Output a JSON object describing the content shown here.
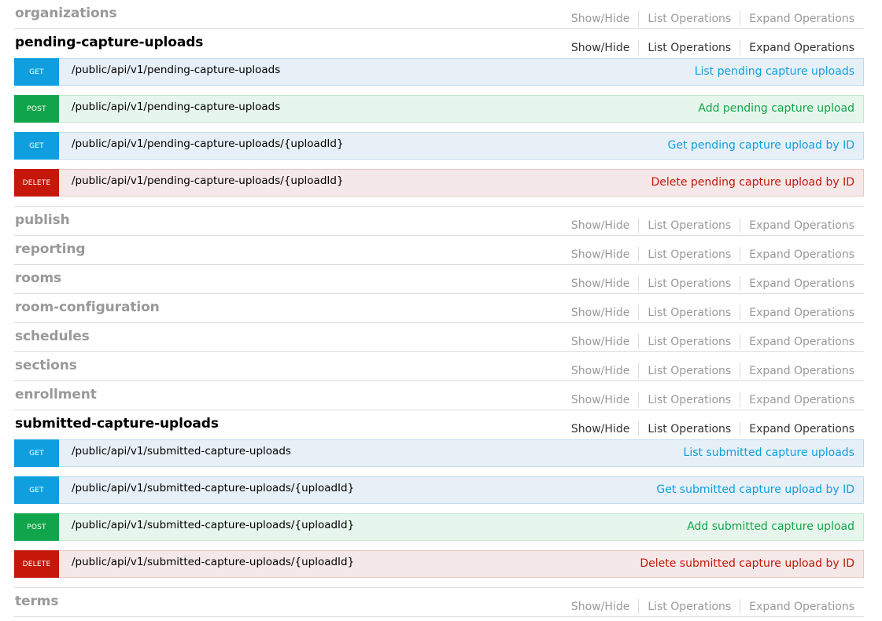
{
  "ops": {
    "show_hide": "Show/Hide",
    "list": "List Operations",
    "expand": "Expand Operations"
  },
  "sections": [
    {
      "name": "organizations",
      "expanded": false
    },
    {
      "name": "pending-capture-uploads",
      "expanded": true,
      "endpoints": [
        {
          "method": "GET",
          "path": "/public/api/v1/pending-capture-uploads",
          "summary": "List pending capture uploads"
        },
        {
          "method": "POST",
          "path": "/public/api/v1/pending-capture-uploads",
          "summary": "Add pending capture upload"
        },
        {
          "method": "GET",
          "path": "/public/api/v1/pending-capture-uploads/{uploadId}",
          "summary": "Get pending capture upload by ID"
        },
        {
          "method": "DELETE",
          "path": "/public/api/v1/pending-capture-uploads/{uploadId}",
          "summary": "Delete pending capture upload by ID"
        }
      ]
    },
    {
      "name": "publish",
      "expanded": false
    },
    {
      "name": "reporting",
      "expanded": false
    },
    {
      "name": "rooms",
      "expanded": false
    },
    {
      "name": "room-configuration",
      "expanded": false
    },
    {
      "name": "schedules",
      "expanded": false
    },
    {
      "name": "sections",
      "expanded": false
    },
    {
      "name": "enrollment",
      "expanded": false
    },
    {
      "name": "submitted-capture-uploads",
      "expanded": true,
      "endpoints": [
        {
          "method": "GET",
          "path": "/public/api/v1/submitted-capture-uploads",
          "summary": "List submitted capture uploads"
        },
        {
          "method": "GET",
          "path": "/public/api/v1/submitted-capture-uploads/{uploadId}",
          "summary": "Get submitted capture upload by ID"
        },
        {
          "method": "POST",
          "path": "/public/api/v1/submitted-capture-uploads/{uploadId}",
          "summary": "Add submitted capture upload"
        },
        {
          "method": "DELETE",
          "path": "/public/api/v1/submitted-capture-uploads/{uploadId}",
          "summary": "Delete submitted capture upload by ID"
        }
      ]
    },
    {
      "name": "terms",
      "expanded": false
    }
  ]
}
